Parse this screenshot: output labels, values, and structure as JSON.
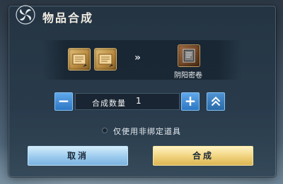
{
  "dialog": {
    "title": "物品合成",
    "emblem_icon": "pinwheel-emblem-icon"
  },
  "recipe": {
    "inputs": [
      {
        "icon": "scroll-item-icon"
      },
      {
        "icon": "scroll-item-icon"
      }
    ],
    "arrow": "»",
    "output": {
      "icon": "book-item-icon",
      "name": "阴阳密卷"
    }
  },
  "quantity": {
    "label": "合成数量",
    "value": "1",
    "minus_label": "−",
    "plus_label": "+",
    "max_icon": "double-chevron-up-icon"
  },
  "option": {
    "label": "仅使用非绑定道具",
    "checked": false
  },
  "buttons": {
    "cancel": "取消",
    "confirm": "合成"
  },
  "colors": {
    "accent_blue": "#2e77c4",
    "confirm_gold": "#f0d27c",
    "cancel_blue": "#9ccbee"
  }
}
